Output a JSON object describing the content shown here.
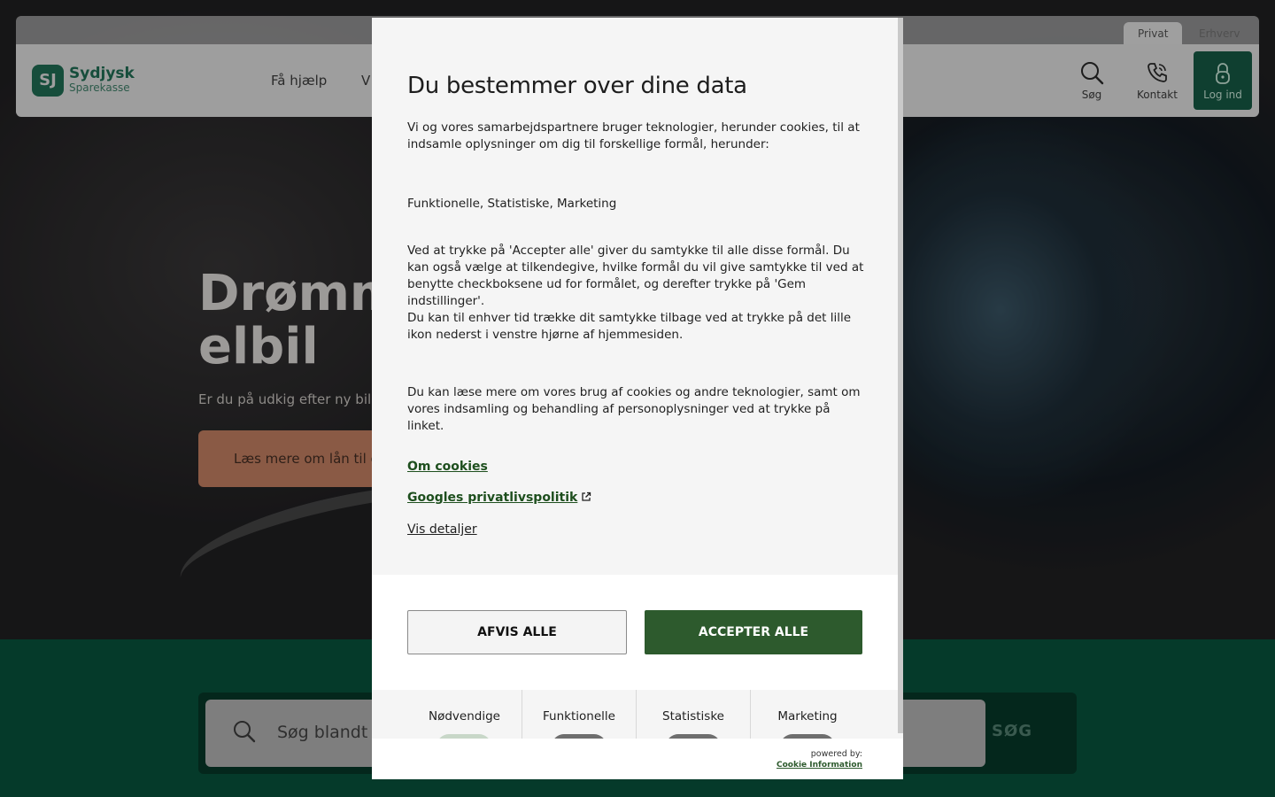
{
  "topbar": {
    "segments": [
      "Privat",
      "Erhverv"
    ]
  },
  "logo": {
    "mark": "SJ",
    "name": "Sydjysk",
    "sub": "Sparekasse"
  },
  "nav": {
    "links": [
      "Få hjælp",
      "V"
    ],
    "search_label": "Søg",
    "contact_label": "Kontakt",
    "login_label": "Log ind"
  },
  "hero": {
    "title_line1": "Drømme",
    "title_line2": "elbil",
    "subtitle": "Er du på udkig efter ny bil, o",
    "cta": "Læs mere om lån til el"
  },
  "search": {
    "placeholder": "Søg blandt v",
    "button": "SØG"
  },
  "modal": {
    "title": "Du bestemmer over dine data",
    "p1": "Vi og vores samarbejdspartnere bruger teknologier, herunder cookies, til at indsamle oplysninger om dig til forskellige formål, herunder:",
    "p2": "Funktionelle, Statistiske, Marketing",
    "p3": "Ved at trykke på 'Accepter alle' giver du samtykke til alle disse formål. Du kan også vælge at tilkendegive, hvilke formål du vil give samtykke til ved at benytte checkboksene ud for formålet, og derefter trykke på 'Gem indstillinger'.",
    "p4": "Du kan til enhver tid trække dit samtykke tilbage ved at trykke på det lille ikon nederst i venstre hjørne af hjemmesiden.",
    "p5": "Du kan læse mere om vores brug af cookies og andre teknologier, samt om vores indsamling og behandling af personoplysninger ved at trykke på linket.",
    "link_cookies": "Om cookies",
    "link_google": "Googles privatlivspolitik",
    "link_details": "Vis detaljer",
    "btn_reject": "AFVIS ALLE",
    "btn_accept": "ACCEPTER ALLE",
    "categories": [
      "Nødvendige",
      "Funktionelle",
      "Statistiske",
      "Marketing"
    ],
    "powered_by": "powered by:",
    "powered_link": "Cookie Information"
  },
  "colors": {
    "accent": "#2d5a2d",
    "brand": "#0b3b2c"
  }
}
